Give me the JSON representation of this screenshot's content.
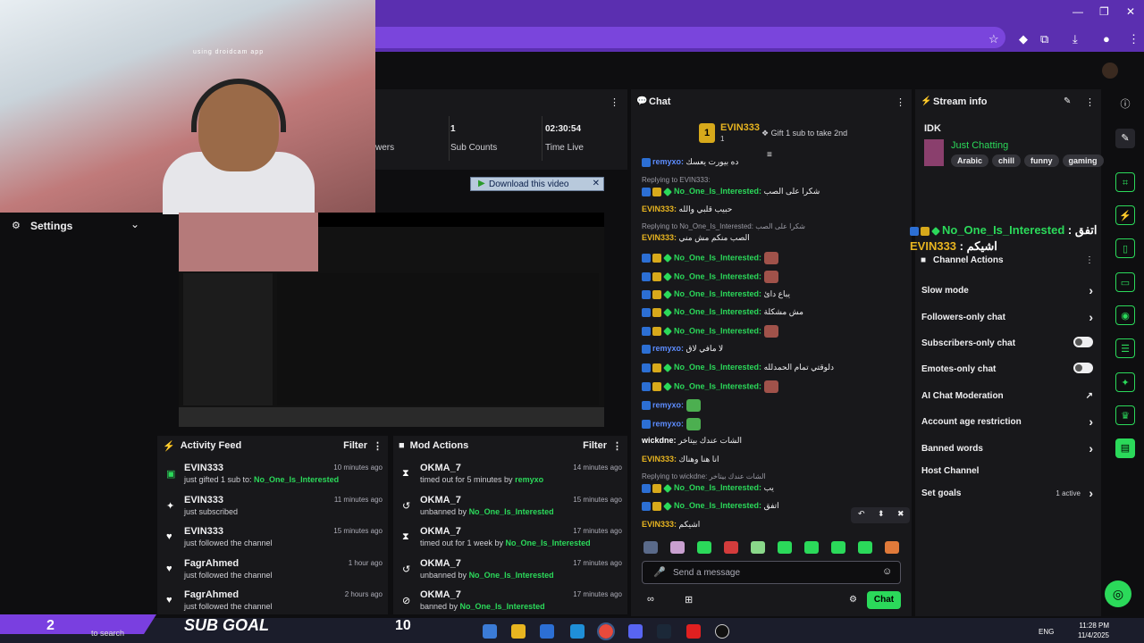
{
  "webcam": {
    "label": "using droidcam app"
  },
  "settings": {
    "title": "Settings"
  },
  "stats": {
    "followers_label": "wers",
    "sub_counts_value": "1",
    "sub_counts_label": "Sub Counts",
    "time_live_value": "02:30:54",
    "time_live_label": "Time Live"
  },
  "download_button": {
    "label": "Download this video"
  },
  "activity_feed": {
    "title": "Activity Feed",
    "filter": "Filter",
    "items": [
      {
        "icon": "gift-icon",
        "name": "EVIN333",
        "desc_pre": "just gifted 1 sub to: ",
        "desc_link": "No_One_Is_Interested",
        "time": "10 minutes ago"
      },
      {
        "icon": "star-icon",
        "name": "EVIN333",
        "desc_pre": "just subscribed",
        "desc_link": "",
        "time": "11 minutes ago"
      },
      {
        "icon": "heart-icon",
        "name": "EVIN333",
        "desc_pre": "just followed the channel",
        "desc_link": "",
        "time": "15 minutes ago"
      },
      {
        "icon": "heart-icon",
        "name": "FagrAhmed",
        "desc_pre": "just followed the channel",
        "desc_link": "",
        "time": "1 hour ago"
      },
      {
        "icon": "heart-icon",
        "name": "FagrAhmed",
        "desc_pre": "just followed the channel",
        "desc_link": "",
        "time": "2 hours ago"
      }
    ]
  },
  "mod_actions": {
    "title": "Mod Actions",
    "filter": "Filter",
    "items": [
      {
        "icon": "hourglass-icon",
        "name": "OKMA_7",
        "desc_pre": "timed out for 5 minutes by ",
        "desc_link": "remyxo",
        "time": "14 minutes ago"
      },
      {
        "icon": "undo-icon",
        "name": "OKMA_7",
        "desc_pre": "unbanned by ",
        "desc_link": "No_One_Is_Interested",
        "time": "15 minutes ago"
      },
      {
        "icon": "hourglass-icon",
        "name": "OKMA_7",
        "desc_pre": "timed out for 1 week by ",
        "desc_link": "No_One_Is_Interested",
        "time": "17 minutes ago"
      },
      {
        "icon": "undo-icon",
        "name": "OKMA_7",
        "desc_pre": "unbanned by ",
        "desc_link": "No_One_Is_Interested",
        "time": "17 minutes ago"
      },
      {
        "icon": "ban-icon",
        "name": "OKMA_7",
        "desc_pre": "banned by ",
        "desc_link": "No_One_Is_Interested",
        "time": "17 minutes ago"
      }
    ]
  },
  "chat": {
    "title": "Chat",
    "top_gifter": "EVIN333",
    "top_gifter_count": "1",
    "gift_prompt": "Gift 1 sub to take 2nd",
    "input_placeholder": "Send a message",
    "send_label": "Chat",
    "lines": [
      {
        "reply": "",
        "name": "remyxo:",
        "cls": "n3",
        "badges": 1,
        "msg": "ده بيورت يعسك"
      },
      {
        "reply": "Replying to EVIN333:",
        "name": "",
        "cls": "",
        "badges": 0,
        "msg": ""
      },
      {
        "reply": "",
        "name": "No_One_Is_Interested:",
        "cls": "n1",
        "badges": 3,
        "msg": "شكرا على الصب"
      },
      {
        "reply": "",
        "name": "EVIN333:",
        "cls": "n2",
        "badges": 0,
        "msg": "حبيب قلبي والله"
      },
      {
        "reply": "Replying to No_One_Is_Interested: شكرا على الصب",
        "name": "",
        "cls": "",
        "badges": 0,
        "msg": ""
      },
      {
        "reply": "",
        "name": "EVIN333:",
        "cls": "n2",
        "badges": 0,
        "msg": "الصب منكم مش مني"
      },
      {
        "reply": "",
        "name": "No_One_Is_Interested:",
        "cls": "n1",
        "badges": 3,
        "msg": ""
      },
      {
        "reply": "",
        "name": "No_One_Is_Interested:",
        "cls": "n1",
        "badges": 3,
        "msg": ""
      },
      {
        "reply": "",
        "name": "No_One_Is_Interested:",
        "cls": "n1",
        "badges": 3,
        "msg": "يباع دائ"
      },
      {
        "reply": "",
        "name": "No_One_Is_Interested:",
        "cls": "n1",
        "badges": 3,
        "msg": "مش مشكلة"
      },
      {
        "reply": "",
        "name": "No_One_Is_Interested:",
        "cls": "n1",
        "badges": 3,
        "msg": ""
      },
      {
        "reply": "",
        "name": "remyxo:",
        "cls": "n3",
        "badges": 1,
        "msg": "لا مافي لاق"
      },
      {
        "reply": "",
        "name": "No_One_Is_Interested:",
        "cls": "n1",
        "badges": 3,
        "msg": "دلوقتي تمام الحمدلله"
      },
      {
        "reply": "",
        "name": "No_One_Is_Interested:",
        "cls": "n1",
        "badges": 3,
        "msg": ""
      },
      {
        "reply": "",
        "name": "remyxo:",
        "cls": "n3",
        "badges": 1,
        "msg": ""
      },
      {
        "reply": "",
        "name": "remyxo:",
        "cls": "n3",
        "badges": 1,
        "msg": ""
      },
      {
        "reply": "",
        "name": "wickdne:",
        "cls": "n4",
        "badges": 0,
        "msg": "الشات عندك بيتاخر"
      },
      {
        "reply": "",
        "name": "EVIN333:",
        "cls": "n2",
        "badges": 0,
        "msg": "انا هنا وهناك"
      },
      {
        "reply": "Replying to wickdne: الشات عندك بيتاخر",
        "name": "",
        "cls": "",
        "badges": 0,
        "msg": ""
      },
      {
        "reply": "",
        "name": "No_One_Is_Interested:",
        "cls": "n1",
        "badges": 3,
        "msg": "يب"
      },
      {
        "reply": "",
        "name": "No_One_Is_Interested:",
        "cls": "n1",
        "badges": 3,
        "msg": "اتفق"
      },
      {
        "reply": "",
        "name": "EVIN333:",
        "cls": "n2",
        "badges": 0,
        "msg": "اشيكم"
      }
    ]
  },
  "stream_info": {
    "title": "Stream info",
    "stream_title": "IDK",
    "category": "Just Chatting",
    "tags": [
      "Arabic",
      "chill",
      "funny",
      "gaming"
    ]
  },
  "overlay_alert": {
    "name": "No_One_Is_Interested",
    "msg": "اتفق",
    "name2": "EVIN333",
    "msg2": "اشيكم"
  },
  "channel_actions": {
    "title": "Channel Actions",
    "items": [
      {
        "label": "Slow mode",
        "type": "arrow"
      },
      {
        "label": "Followers-only chat",
        "type": "arrow"
      },
      {
        "label": "Subscribers-only chat",
        "type": "toggle"
      },
      {
        "label": "Emotes-only chat",
        "type": "toggle"
      },
      {
        "label": "AI Chat Moderation",
        "type": "ext"
      },
      {
        "label": "Account age restriction",
        "type": "arrow"
      },
      {
        "label": "Banned words",
        "type": "arrow"
      },
      {
        "label": "Host Channel",
        "type": "none"
      },
      {
        "label": "Set goals",
        "type": "arrow"
      }
    ],
    "goals_status": "1 active"
  },
  "sub_goal": {
    "current": "2",
    "label": "SUB GOAL",
    "target": "10"
  },
  "taskbar": {
    "search": "to search",
    "time": "11:28 PM",
    "date": "11/4/2025",
    "lang": "ENG"
  },
  "colors": {
    "accent": "#2bd95a",
    "purple": "#5b2fb0"
  }
}
